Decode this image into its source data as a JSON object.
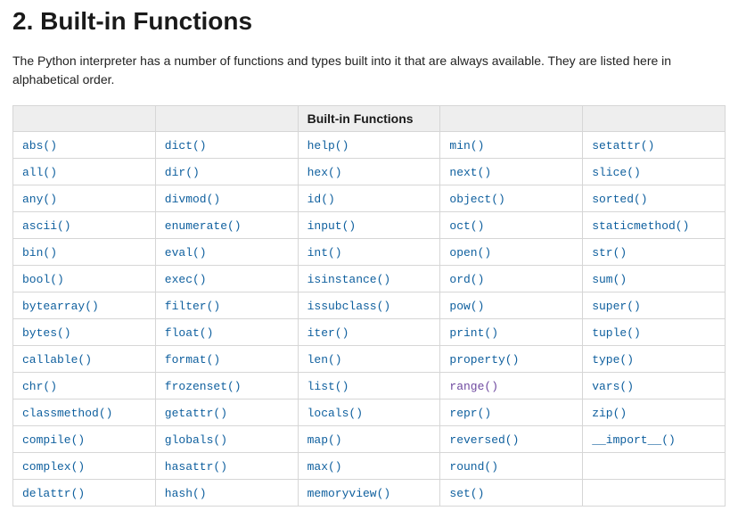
{
  "heading": "2. Built-in Functions",
  "intro": "The Python interpreter has a number of functions and types built into it that are always available. They are listed here in alphabetical order.",
  "table_header": "Built-in Functions",
  "visited_functions": [
    "range()"
  ],
  "columns": [
    [
      "abs()",
      "all()",
      "any()",
      "ascii()",
      "bin()",
      "bool()",
      "bytearray()",
      "bytes()",
      "callable()",
      "chr()",
      "classmethod()",
      "compile()",
      "complex()",
      "delattr()"
    ],
    [
      "dict()",
      "dir()",
      "divmod()",
      "enumerate()",
      "eval()",
      "exec()",
      "filter()",
      "float()",
      "format()",
      "frozenset()",
      "getattr()",
      "globals()",
      "hasattr()",
      "hash()"
    ],
    [
      "help()",
      "hex()",
      "id()",
      "input()",
      "int()",
      "isinstance()",
      "issubclass()",
      "iter()",
      "len()",
      "list()",
      "locals()",
      "map()",
      "max()",
      "memoryview()"
    ],
    [
      "min()",
      "next()",
      "object()",
      "oct()",
      "open()",
      "ord()",
      "pow()",
      "print()",
      "property()",
      "range()",
      "repr()",
      "reversed()",
      "round()",
      "set()"
    ],
    [
      "setattr()",
      "slice()",
      "sorted()",
      "staticmethod()",
      "str()",
      "sum()",
      "super()",
      "tuple()",
      "type()",
      "vars()",
      "zip()",
      "__import__()",
      "",
      ""
    ]
  ]
}
